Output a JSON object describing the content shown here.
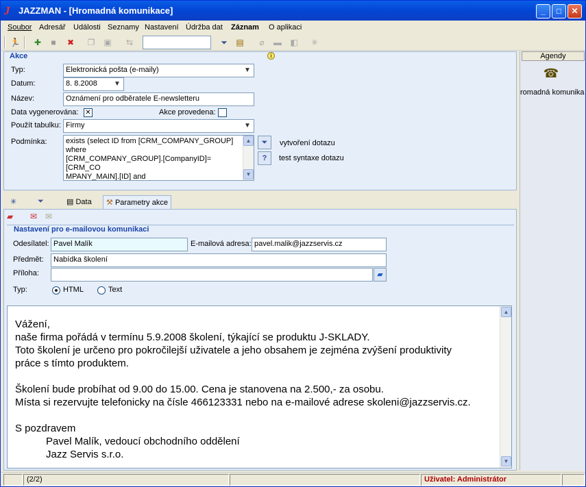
{
  "titlebar": {
    "title": "JAZZMAN - [Hromadná komunikace]",
    "min": "_",
    "max": "□",
    "close": "✕"
  },
  "menu": [
    "Soubor",
    "Adresář",
    "Události",
    "Seznamy",
    "Nastavení",
    "Údržba dat",
    "Záznam",
    "O aplikaci"
  ],
  "akce": {
    "section_title": "Akce",
    "typ_label": "Typ:",
    "typ_value": "Elektronická pošta (e-maily)",
    "datum_label": "Datum:",
    "datum_value": "8. 8.2008",
    "nazev_label": "Název:",
    "nazev_value": "Oznámení pro odběratele E-newsletteru",
    "data_vyg_label": "Data vygenerována:",
    "data_vyg_mark": "✕",
    "akce_provedena_label": "Akce provedena:",
    "tabulka_label": "Použít tabulku:",
    "tabulka_value": "Firmy",
    "podminka_label": "Podmínka:",
    "podminka_lines": [
      "exists (select ID from [CRM_COMPANY_GROUP]",
      "where",
      "[CRM_COMPANY_GROUP].[CompanyID]=[CRM_CO",
      "MPANY_MAIN].[ID] and"
    ],
    "vytvoreni_label": "vytvoření dotazu",
    "test_label": "test syntaxe dotazu"
  },
  "tabs": {
    "data": "Data",
    "parametry": "Parametry akce"
  },
  "email": {
    "section_title": "Nastavení pro e-mailovou komunikaci",
    "odesilatel_label": "Odesílatel:",
    "odesilatel_value": "Pavel Malík",
    "adresa_label": "E-mailová adresa:",
    "adresa_value": "pavel.malik@jazzservis.cz",
    "predmet_label": "Předmět:",
    "predmet_value": "Nabídka školení",
    "priloha_label": "Příloha:",
    "priloha_value": "",
    "typ_label": "Typ:",
    "html_label": "HTML",
    "text_label": "Text"
  },
  "message_lines": [
    "Vážení,",
    "naše firma pořádá v termínu 5.9.2008 školení, týkající se produktu J-SKLADY.",
    "Toto školení je určeno pro pokročilejší uživatele a jeho obsahem je zejména zvýšení produktivity",
    "práce s tímto produktem.",
    "",
    "Školení bude probíhat od 9.00 do 15.00. Cena je stanovena na 2.500,- za osobu.",
    "Místa si rezervujte telefonicky na čísle 466123331 nebo na e-mailové adrese skoleni@jazzservis.cz.",
    "",
    "S pozdravem",
    "Pavel Malík, vedoucí obchodního oddělení",
    "Jazz Servis s.r.o."
  ],
  "sidebar": {
    "header": "Agendy",
    "item": "romadná komunikac"
  },
  "status": {
    "record": "(2/2)",
    "user": "Uživatel: Administrátor"
  },
  "colors": {
    "accent": "#1843A8",
    "status_user": "#B00000"
  }
}
